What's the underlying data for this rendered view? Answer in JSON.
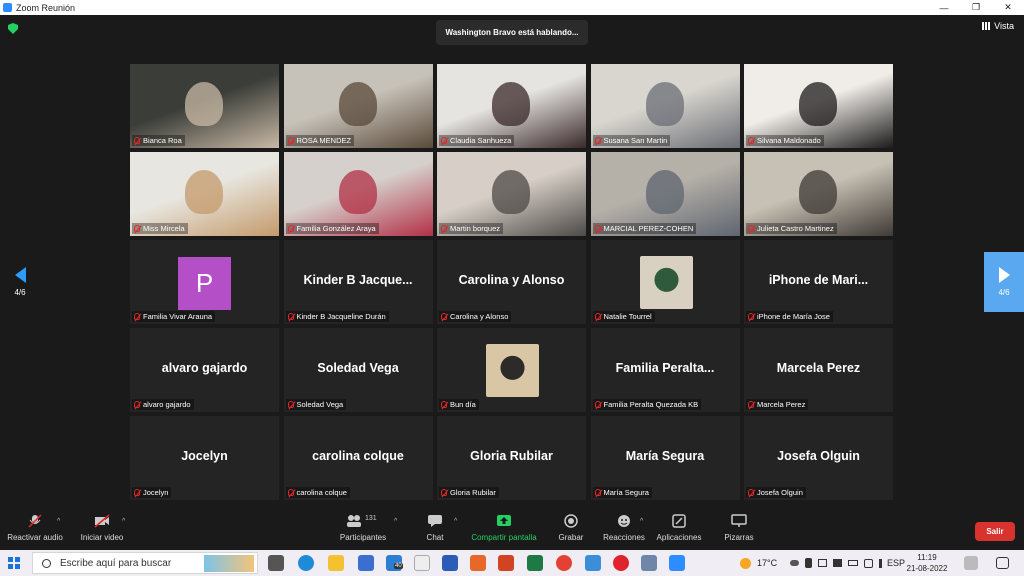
{
  "window": {
    "title": "Zoom Reunión",
    "minimize": "—",
    "maximize": "❐",
    "close": "✕"
  },
  "meeting": {
    "speaking_banner": "Washington Bravo está hablando...",
    "view_label": "Vista"
  },
  "pagination": {
    "left": "4/6",
    "right": "4/6"
  },
  "tiles": [
    {
      "label": "Bianca Roa",
      "type": "video",
      "colors": [
        "#3a3d38",
        "#c9b9a6"
      ]
    },
    {
      "label": "ROSA MENDEZ",
      "type": "video",
      "colors": [
        "#c7c2b9",
        "#5a4a3a"
      ]
    },
    {
      "label": "Claudia Sanhueza",
      "type": "video",
      "colors": [
        "#e5e4e0",
        "#3a2a2a"
      ]
    },
    {
      "label": "Susana San Martin",
      "type": "video",
      "colors": [
        "#d9d6cf",
        "#6b6d75"
      ]
    },
    {
      "label": "Silvana Maldonado",
      "type": "video",
      "colors": [
        "#f0ede8",
        "#1d1b1b"
      ]
    },
    {
      "label": "Miss Mircela",
      "type": "video",
      "colors": [
        "#e8e6e0",
        "#c49a6b"
      ]
    },
    {
      "label": "Familia González Araya",
      "type": "video",
      "colors": [
        "#d6d0cc",
        "#b23046"
      ]
    },
    {
      "label": "Martin borquez",
      "type": "video",
      "colors": [
        "#d7cfc7",
        "#4d4a47"
      ]
    },
    {
      "label": "MARCIAL PEREZ-COHEN",
      "type": "video",
      "colors": [
        "#b5b0a8",
        "#5f6570"
      ]
    },
    {
      "label": "Julieta Castro Martinez",
      "type": "video",
      "colors": [
        "#c7c0b4",
        "#3f3a35"
      ]
    },
    {
      "label": "Familia Vivar Arauna",
      "type": "avatar",
      "avatar_letter": "P",
      "avatar_color": "#b44fc8"
    },
    {
      "label": "Kinder B Jacqueline Durán",
      "type": "name",
      "display_name": "Kinder B Jacque..."
    },
    {
      "label": "Carolina y Alonso",
      "type": "name",
      "display_name": "Carolina y Alonso"
    },
    {
      "label": "Natalie Tourrel",
      "type": "photo",
      "colors": [
        "#d8d0c0",
        "#2f5a3c"
      ]
    },
    {
      "label": "iPhone de María Jose",
      "type": "name",
      "display_name": "iPhone de Mari..."
    },
    {
      "label": "alvaro gajardo",
      "type": "name",
      "display_name": "alvaro gajardo"
    },
    {
      "label": "Soledad Vega",
      "type": "name",
      "display_name": "Soledad Vega"
    },
    {
      "label": "Bun día",
      "type": "photo",
      "colors": [
        "#d9c6a5",
        "#2d2a2a"
      ]
    },
    {
      "label": "Familia Peralta Quezada KB",
      "type": "name",
      "display_name": "Familia Peralta..."
    },
    {
      "label": "Marcela Perez",
      "type": "name",
      "display_name": "Marcela Perez"
    },
    {
      "label": "Jocelyn",
      "type": "name",
      "display_name": "Jocelyn"
    },
    {
      "label": "carolina colque",
      "type": "name",
      "display_name": "carolina colque"
    },
    {
      "label": "Gloria Rubilar",
      "type": "name",
      "display_name": "Gloria Rubilar"
    },
    {
      "label": "María Segura",
      "type": "name",
      "display_name": "María Segura"
    },
    {
      "label": "Josefa Olguin",
      "type": "name",
      "display_name": "Josefa Olguin"
    }
  ],
  "toolbar": {
    "audio": "Reactivar audio",
    "video": "Iniciar video",
    "participants": "Participantes",
    "participants_count": "131",
    "chat": "Chat",
    "share": "Compartir pantalla",
    "record": "Grabar",
    "reactions": "Reacciones",
    "apps": "Aplicaciones",
    "whiteboards": "Pizarras",
    "leave": "Salir"
  },
  "taskbar": {
    "search_placeholder": "Escribe aquí para buscar",
    "mail_badge": "40",
    "temperature": "17°C",
    "language": "ESP",
    "time": "11:19",
    "date": "21-08-2022"
  },
  "colors": {
    "share_green": "#23d160",
    "leave_red": "#d8332f",
    "accent_blue": "#2d8cff"
  }
}
